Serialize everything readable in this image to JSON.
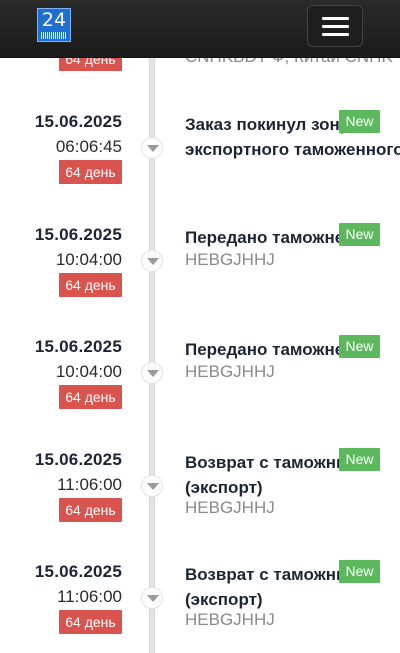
{
  "header": {
    "logo_text": "24",
    "menu_icon": "hamburger-menu-icon"
  },
  "partial_item": {
    "days": "64 день",
    "text": "CNHKBDT Ф, Китай CNHK"
  },
  "events": [
    {
      "date": "15.06.2025",
      "time": "06:06:45",
      "days": "64 день",
      "title": "Заказ покинул зону",
      "title_line2": "экспортного таможенного",
      "subtitle": "",
      "badge": "New"
    },
    {
      "date": "15.06.2025",
      "time": "10:04:00",
      "days": "64 день",
      "title": "Передано таможне",
      "title_line2": "",
      "subtitle": "HEBGJHHJ",
      "badge": "New"
    },
    {
      "date": "15.06.2025",
      "time": "10:04:00",
      "days": "64 день",
      "title": "Передано таможне",
      "title_line2": "",
      "subtitle": "HEBGJHHJ",
      "badge": "New"
    },
    {
      "date": "15.06.2025",
      "time": "11:06:00",
      "days": "64 день",
      "title": "Возврат с таможни",
      "title_line2": "(экспорт)",
      "subtitle": "HEBGJHHJ",
      "badge": "New"
    },
    {
      "date": "15.06.2025",
      "time": "11:06:00",
      "days": "64 день",
      "title": "Возврат с таможни",
      "title_line2": "(экспорт)",
      "subtitle": "HEBGJHHJ",
      "badge": "New"
    }
  ],
  "colors": {
    "days_badge": "#d9534f",
    "new_badge": "#5cb85c",
    "header_bg": "#222222",
    "logo_bg": "#1f6fd1"
  }
}
